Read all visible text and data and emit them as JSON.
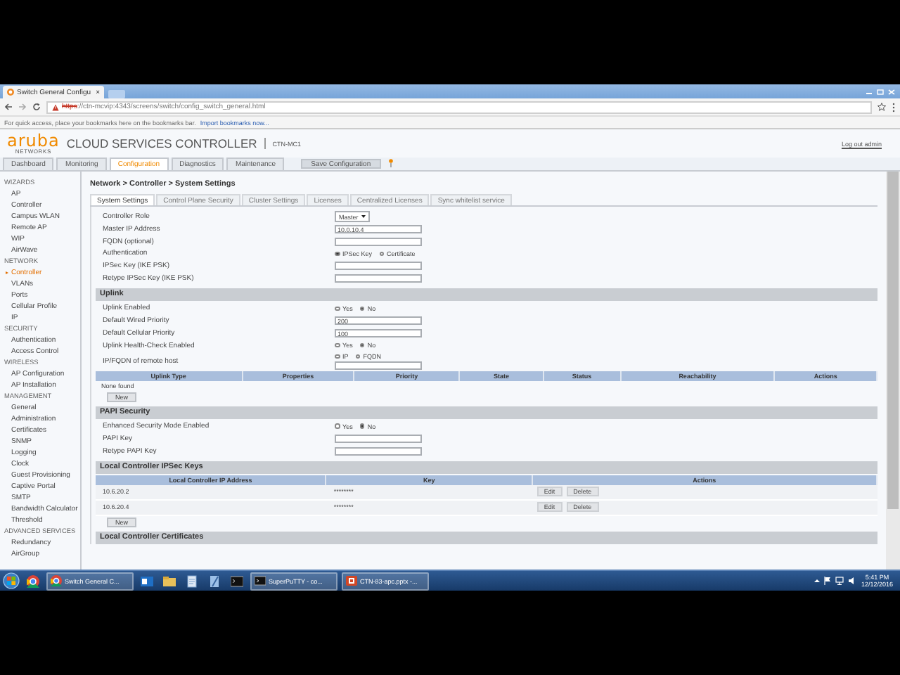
{
  "browser": {
    "tab_title": "Switch General Configu",
    "tab_close": "×",
    "url_scheme": "https",
    "url_rest": "://ctn-mcvip:4343/screens/switch/config_switch_general.html",
    "bookmarks_hint": "For quick access, place your bookmarks here on the bookmarks bar.",
    "bookmarks_link": "Import bookmarks now..."
  },
  "header": {
    "brand": "aruba",
    "brand_sub": "NETWORKS",
    "product": "CLOUD SERVICES CONTROLLER",
    "host": "CTN-MC1",
    "logout": "Log out admin"
  },
  "nav_tabs": [
    {
      "label": "Dashboard",
      "selected": false
    },
    {
      "label": "Monitoring",
      "selected": false
    },
    {
      "label": "Configuration",
      "selected": true
    },
    {
      "label": "Diagnostics",
      "selected": false
    },
    {
      "label": "Maintenance",
      "selected": false
    }
  ],
  "save_button": "Save Configuration",
  "sidebar": [
    {
      "heading": "WIZARDS",
      "items": [
        {
          "label": "AP",
          "selected": false
        },
        {
          "label": "Controller",
          "selected": false
        },
        {
          "label": "Campus WLAN",
          "selected": false
        },
        {
          "label": "Remote AP",
          "selected": false
        },
        {
          "label": "WIP",
          "selected": false
        },
        {
          "label": "AirWave",
          "selected": false
        }
      ]
    },
    {
      "heading": "NETWORK",
      "items": [
        {
          "label": "Controller",
          "selected": true
        },
        {
          "label": "VLANs",
          "selected": false
        },
        {
          "label": "Ports",
          "selected": false
        },
        {
          "label": "Cellular Profile",
          "selected": false
        },
        {
          "label": "IP",
          "selected": false
        }
      ]
    },
    {
      "heading": "SECURITY",
      "items": [
        {
          "label": "Authentication",
          "selected": false
        },
        {
          "label": "Access Control",
          "selected": false
        }
      ]
    },
    {
      "heading": "WIRELESS",
      "items": [
        {
          "label": "AP Configuration",
          "selected": false
        },
        {
          "label": "AP Installation",
          "selected": false
        }
      ]
    },
    {
      "heading": "MANAGEMENT",
      "items": [
        {
          "label": "General",
          "selected": false
        },
        {
          "label": "Administration",
          "selected": false
        },
        {
          "label": "Certificates",
          "selected": false
        },
        {
          "label": "SNMP",
          "selected": false
        },
        {
          "label": "Logging",
          "selected": false
        },
        {
          "label": "Clock",
          "selected": false
        },
        {
          "label": "Guest Provisioning",
          "selected": false
        },
        {
          "label": "Captive Portal",
          "selected": false
        },
        {
          "label": "SMTP",
          "selected": false
        },
        {
          "label": "Bandwidth Calculator",
          "selected": false
        },
        {
          "label": "Threshold",
          "selected": false
        }
      ]
    },
    {
      "heading": "ADVANCED SERVICES",
      "items": [
        {
          "label": "Redundancy",
          "selected": false
        },
        {
          "label": "AirGroup",
          "selected": false
        }
      ]
    }
  ],
  "breadcrumb": "Network > Controller > System Settings",
  "sub_tabs": [
    {
      "label": "System Settings",
      "selected": true
    },
    {
      "label": "Control Plane Security",
      "selected": false
    },
    {
      "label": "Cluster Settings",
      "selected": false
    },
    {
      "label": "Licenses",
      "selected": false
    },
    {
      "label": "Centralized Licenses",
      "selected": false
    },
    {
      "label": "Sync whitelist service",
      "selected": false
    }
  ],
  "fields": [
    {
      "label": "Controller Role",
      "kind": "select",
      "value": "Master"
    },
    {
      "label": "Master IP Address",
      "kind": "text",
      "value": "10.0.10.4"
    },
    {
      "label": "FQDN (optional)",
      "kind": "text"
    },
    {
      "label": "Authentication",
      "kind": "radio",
      "options": [
        {
          "label": "IPSec Key",
          "selected": true
        },
        {
          "label": "Certificate",
          "selected": false
        }
      ]
    },
    {
      "label": "IPSec Key (IKE PSK)",
      "kind": "text"
    },
    {
      "label": "Retype IPSec Key (IKE PSK)",
      "kind": "text"
    }
  ],
  "sections": [
    {
      "title": "Uplink",
      "fields": [
        {
          "label": "Uplink Enabled",
          "kind": "radio",
          "options": [
            {
              "label": "Yes",
              "selected": false
            },
            {
              "label": "No",
              "selected": true
            }
          ]
        },
        {
          "label": "Default Wired Priority",
          "kind": "text",
          "value": "200"
        },
        {
          "label": "Default Cellular Priority",
          "kind": "text",
          "value": "100"
        },
        {
          "label": "Uplink Health-Check Enabled",
          "kind": "radio",
          "options": [
            {
              "label": "Yes",
              "selected": false
            },
            {
              "label": "No",
              "selected": true
            }
          ]
        },
        {
          "label": "IP/FQDN of remote host",
          "kind": "radio_text",
          "options": [
            {
              "label": "IP",
              "selected": false
            },
            {
              "label": "FQDN",
              "selected": false
            }
          ]
        }
      ],
      "table": {
        "columns": [
          "Uplink Type",
          "Properties",
          "Priority",
          "State",
          "Status",
          "Reachability",
          "Actions"
        ],
        "empty_text": "None found"
      },
      "button": "New"
    },
    {
      "title": "PAPI Security",
      "fields": [
        {
          "label": "Enhanced Security Mode Enabled",
          "kind": "radio",
          "options": [
            {
              "label": "Yes",
              "selected": false
            },
            {
              "label": "No",
              "selected": true
            }
          ]
        },
        {
          "label": "PAPI Key",
          "kind": "text"
        },
        {
          "label": "Retype PAPI Key",
          "kind": "text"
        }
      ]
    },
    {
      "title": "Local Controller IPSec Keys",
      "table": {
        "columns": [
          "Local Controller IP Address",
          "Key",
          "Actions"
        ],
        "rows": [
          {
            "cells": [
              "10.6.20.2",
              "********"
            ],
            "actions": [
              "Edit",
              "Delete"
            ]
          },
          {
            "cells": [
              "10.6.20.4",
              "********"
            ],
            "actions": [
              "Edit",
              "Delete"
            ]
          }
        ]
      },
      "button": "New"
    },
    {
      "title": "Local Controller Certificates"
    }
  ],
  "taskbar": {
    "windows": [
      {
        "kind": "browser",
        "label": "Switch General C..."
      },
      {
        "kind": "terminal",
        "label": "SuperPuTTY - co..."
      },
      {
        "kind": "slides",
        "label": "CTN-83-apc.pptx -..."
      }
    ],
    "time": "5:41 PM",
    "date": "12/12/2016"
  }
}
